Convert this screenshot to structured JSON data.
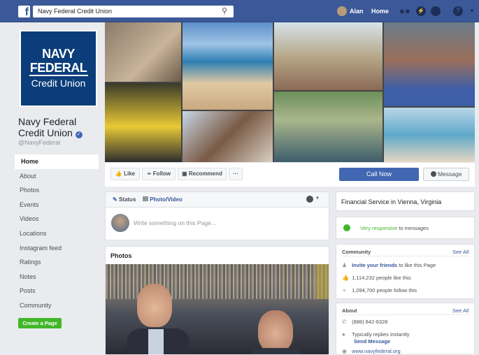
{
  "topbar": {
    "logo": "f",
    "search_value": "Navy Federal Credit Union",
    "search_icon": "search-icon",
    "user_name": "Alan",
    "home_label": "Home",
    "icons": [
      "friends-icon",
      "messenger-icon",
      "globe-icon",
      "help-icon",
      "caret-down-icon"
    ]
  },
  "logo": {
    "line1": "NAVY",
    "line2": "FEDERAL",
    "line3": "Credit Union"
  },
  "page": {
    "name": "Navy Federal Credit Union",
    "handle": "@NavyFederal"
  },
  "menu": [
    "Home",
    "About",
    "Photos",
    "Events",
    "Videos",
    "Locations",
    "Instagram feed",
    "Ratings",
    "Notes",
    "Posts",
    "Community"
  ],
  "create_page": "Create a Page",
  "actions": {
    "like": "Like",
    "follow": "Follow",
    "recommend": "Recommend",
    "more": "···",
    "call_now": "Call Now",
    "message": "Message"
  },
  "composer": {
    "status": "Status",
    "photo_video": "Photo/Video",
    "placeholder": "Write something on this Page..."
  },
  "photos": {
    "title": "Photos"
  },
  "about_card": {
    "category": "Financial Service in Vienna, Virginia"
  },
  "responsive": {
    "highlight": "Very responsive",
    "rest": " to messages"
  },
  "community": {
    "title": "Community",
    "see_all": "See All",
    "invite_link": "Invite your friends",
    "invite_rest": " to like this Page",
    "likes": "1,114,232 people like this",
    "follows": "1,094,700 people follow this"
  },
  "about": {
    "title": "About",
    "see_all": "See All",
    "phone": "(888) 842-6328",
    "reply": "Typically replies instantly",
    "send_message": "Send Message",
    "website": "www.navyfederal.org"
  },
  "colors": {
    "brand": "#3b5998",
    "button": "#4267b2",
    "green": "#42b72a",
    "navy_logo": "#0b3d7a"
  }
}
